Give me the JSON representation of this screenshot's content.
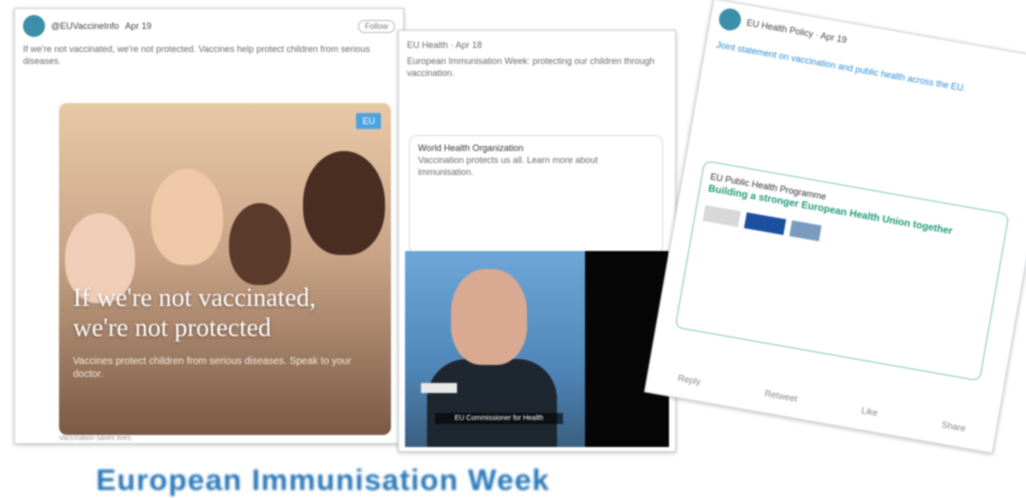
{
  "card1": {
    "author": "@EUVaccineInfo",
    "handle": "@EUVaccineInfo",
    "date": "Apr 19",
    "follow_label": "Follow",
    "body": "If we're not vaccinated, we're not protected. Vaccines help protect children from serious diseases.",
    "badge": "EU",
    "headline_line1": "If we're not vaccinated,",
    "headline_line2": "we're not protected",
    "subtext": "Vaccines protect children from serious diseases. Speak to your doctor.",
    "caption": "Vaccination saves lives"
  },
  "card2": {
    "header": "EU Health · Apr 18",
    "body": "European Immunisation Week: protecting our children through vaccination.",
    "quote_author": "World Health Organization",
    "quote_body": "Vaccination protects us all. Learn more about immunisation.",
    "video_caption": "EU Commissioner for Health"
  },
  "card3": {
    "header": "EU Health Policy · Apr 19",
    "body": "Joint statement on vaccination and public health across the EU.",
    "section_label": "EU Public Health Programme",
    "headline": "Building a stronger European Health Union together",
    "actions": [
      "Reply",
      "Retweet",
      "Like",
      "Share"
    ]
  },
  "bottom_caption": "European Immunisation Week"
}
